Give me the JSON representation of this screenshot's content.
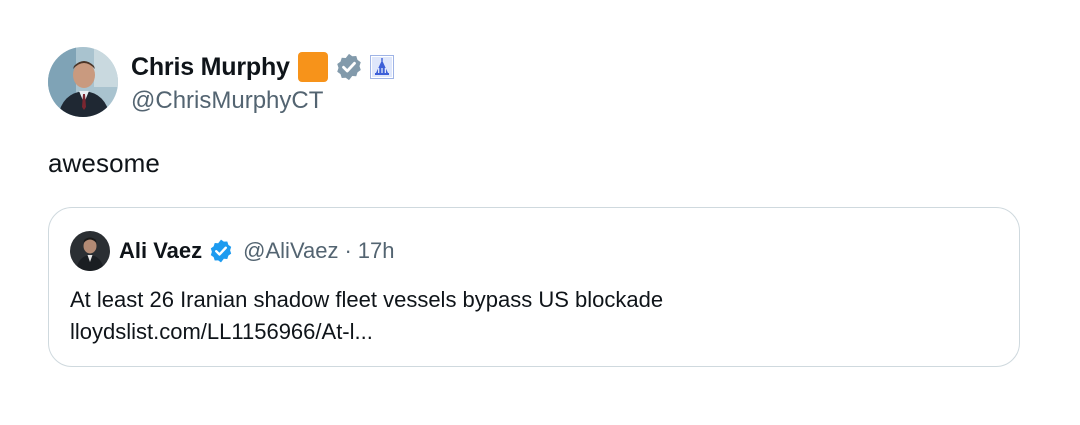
{
  "tweet": {
    "author": {
      "display_name": "Chris Murphy",
      "handle": "@ChrisMurphyCT",
      "avatar_icon": "profile-photo",
      "badges": [
        {
          "name": "orange-square-emoji",
          "color": "#f7931a"
        },
        {
          "name": "gray-verified-icon",
          "color": "#829aab"
        },
        {
          "name": "capitol-affiliation-icon",
          "color": "#3c5fd8"
        }
      ]
    },
    "text": "awesome",
    "quote": {
      "author": {
        "display_name": "Ali Vaez",
        "handle": "@AliVaez",
        "separator": "·",
        "time": "17h",
        "verified_color": "#1d9bf0"
      },
      "text_line1": "At least 26 Iranian shadow fleet vessels bypass US blockade",
      "link": "lloydslist.com/LL1156966/At-l..."
    }
  }
}
